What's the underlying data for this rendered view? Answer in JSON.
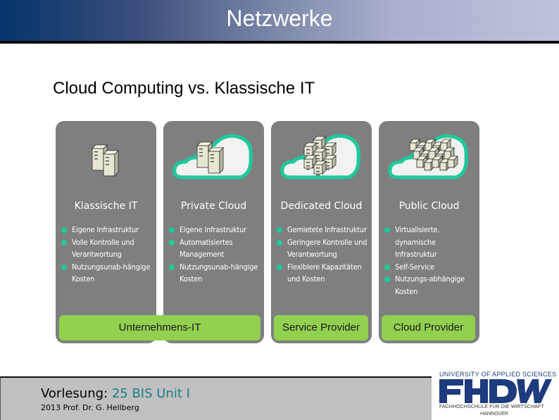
{
  "header": {
    "title": "Netzwerke"
  },
  "slide": {
    "subtitle": "Cloud Computing vs. Klassische IT"
  },
  "columns": [
    {
      "title": "Klassische IT",
      "icon": "server-pair-icon",
      "bullets": [
        "Eigene Infrastruktur",
        "Volle Kontrolle und Verantwortung",
        "Nutzungsunab-hängige Kosten"
      ]
    },
    {
      "title": "Private Cloud",
      "icon": "cloud-server-pair-icon",
      "bullets": [
        "Eigene Infrastruktur",
        "Automatisiertes Management",
        "Nutzungsunab-hängige Kosten"
      ]
    },
    {
      "title": "Dedicated Cloud",
      "icon": "cloud-server-stack-icon",
      "bullets": [
        "Gemietete Infrastruktur",
        "Geringere Kontrolle und Verantwortung",
        "Flexiblere Kapazitäten und Kosten"
      ]
    },
    {
      "title": "Public Cloud",
      "icon": "cloud-server-farm-icon",
      "bullets": [
        "Virtualisierte, dynamische Infrastruktur",
        "Self-Service",
        "Nutzungs-abhängige Kosten"
      ]
    }
  ],
  "group_labels": {
    "enterprise": "Unternehmens-IT",
    "service_provider": "Service Provider",
    "cloud_provider": "Cloud Provider"
  },
  "footer": {
    "lecture_label": "Vorlesung:",
    "lecture_name": "25 BIS Unit I",
    "author": "2013 Prof. Dr. G. Hellberg"
  },
  "logo": {
    "top": "UNIVERSITY OF APPLIED SCIENCES",
    "name": "FHDW",
    "bottom": "FACHHOCHSCHULE FÜR DIE WIRTSCHAFT",
    "city": "HANNOVER"
  },
  "colors": {
    "header_dark": "#05336a",
    "header_light": "#bec2dc",
    "card": "#7f7f7f",
    "bullet": "#1ec99a",
    "cloud_outline": "#1ec99a",
    "group_label": "#92d050",
    "lecture_accent": "#1f8080",
    "logo_blue": "#1d3b7d"
  }
}
